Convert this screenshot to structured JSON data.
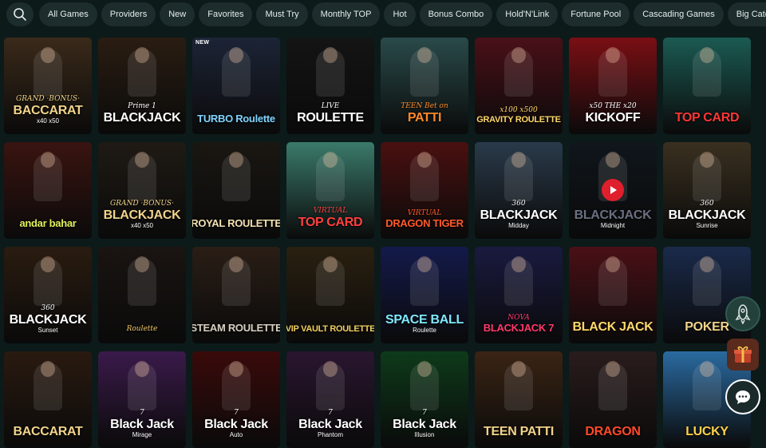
{
  "topbar": {
    "search_icon": "search-icon",
    "categories": [
      "All Games",
      "Providers",
      "New",
      "Favorites",
      "Must Try",
      "Monthly TOP",
      "Hot",
      "Bonus Combo",
      "Hold'N'Link",
      "Fortune Pool",
      "Cascading Games",
      "Big Catch"
    ]
  },
  "games": [
    {
      "sub": "GRAND ·BONUS·",
      "main": "BACCARAT",
      "tag": "x40  x50",
      "bg": "#3a2a1a",
      "accent": "#f2d48a"
    },
    {
      "sub": "Prime 1",
      "main": "BLACKJACK",
      "tag": "",
      "bg": "#2a1d12",
      "accent": "#ffffff"
    },
    {
      "new": "NEW",
      "sub": "",
      "main": "TURBO Roulette",
      "tag": "",
      "bg": "#1c2436",
      "accent": "#7fd4ff"
    },
    {
      "sub": "LIVE",
      "main": "ROULETTE",
      "tag": "",
      "bg": "#141414",
      "accent": "#ffffff"
    },
    {
      "sub": "TEEN Bet on",
      "main": "PATTI",
      "tag": "",
      "bg": "#2a4a4a",
      "accent": "#ff8a2a"
    },
    {
      "sub": "x100  x500",
      "main": "GRAVITY ROULETTE",
      "tag": "",
      "bg": "#4a1018",
      "accent": "#ffd76a"
    },
    {
      "sub": "x50 THE x20",
      "main": "KICKOFF",
      "tag": "",
      "bg": "#7a0f14",
      "accent": "#ffffff"
    },
    {
      "sub": "",
      "main": "TOP CARD",
      "tag": "",
      "bg": "#1b5a52",
      "accent": "#ff3636"
    },
    {
      "sub": "",
      "main": "andar bahar",
      "tag": "",
      "bg": "#3a1410",
      "accent": "#e0f05a"
    },
    {
      "sub": "GRAND ·BONUS·",
      "main": "BLACKJACK",
      "tag": "x40  x50",
      "bg": "#1f1a14",
      "accent": "#f2d48a"
    },
    {
      "sub": "",
      "main": "ROYAL ROULETTE",
      "tag": "",
      "bg": "#1a1712",
      "accent": "#f4e2b0"
    },
    {
      "sub": "VIRTUAL",
      "main": "TOP CARD",
      "tag": "",
      "bg": "#3a7a6a",
      "accent": "#ff4040"
    },
    {
      "sub": "VIRTUAL",
      "main": "DRAGON TIGER",
      "tag": "",
      "bg": "#4a1010",
      "accent": "#ff5a2a"
    },
    {
      "sub": "360",
      "main": "BLACKJACK",
      "tag": "Midday",
      "bg": "#2a3a4a",
      "accent": "#ffffff"
    },
    {
      "sub": "",
      "main": "BLACKJACK",
      "tag": "Midnight",
      "bg": "#10161c",
      "accent": "#6a7080"
    },
    {
      "sub": "360",
      "main": "BLACKJACK",
      "tag": "Sunrise",
      "bg": "#3a3020",
      "accent": "#ffffff"
    },
    {
      "sub": "360",
      "main": "BLACKJACK",
      "tag": "Sunset",
      "bg": "#2a1c10",
      "accent": "#ffffff"
    },
    {
      "sub": "Roulette",
      "main": "",
      "tag": "",
      "bg": "#1a1412",
      "accent": "#f2c86a"
    },
    {
      "sub": "",
      "main": "STEAM ROULETTE",
      "tag": "",
      "bg": "#2a1e16",
      "accent": "#d8d0c0"
    },
    {
      "sub": "",
      "main": "VIP VAULT ROULETTE",
      "tag": "",
      "bg": "#2a2010",
      "accent": "#f2d060"
    },
    {
      "sub": "",
      "main": "SPACE BALL",
      "tag": "Roulette",
      "bg": "#141a4a",
      "accent": "#7fe8ff"
    },
    {
      "sub": "NOVA",
      "main": "BLACKJACK 7",
      "tag": "",
      "bg": "#1a1a40",
      "accent": "#ff3a6a"
    },
    {
      "sub": "",
      "main": "BLACK JACK",
      "tag": "",
      "bg": "#4a1016",
      "accent": "#ffd86a"
    },
    {
      "sub": "",
      "main": "POKER",
      "tag": "",
      "bg": "#1a2a4a",
      "accent": "#f2d48a"
    },
    {
      "sub": "",
      "main": "BACCARAT",
      "tag": "",
      "bg": "#2a1a10",
      "accent": "#f2d48a"
    },
    {
      "sub": "7",
      "main": "Black Jack",
      "tag": "Mirage",
      "bg": "#3a1a4a",
      "accent": "#ffffff"
    },
    {
      "sub": "7",
      "main": "Black Jack",
      "tag": "Auto",
      "bg": "#3a0a0a",
      "accent": "#ffffff"
    },
    {
      "sub": "7",
      "main": "Black Jack",
      "tag": "Phantom",
      "bg": "#2a1630",
      "accent": "#ffffff"
    },
    {
      "sub": "7",
      "main": "Black Jack",
      "tag": "Illusion",
      "bg": "#0e3a1a",
      "accent": "#ffffff"
    },
    {
      "sub": "",
      "main": "TEEN PATTI",
      "tag": "",
      "bg": "#3a2414",
      "accent": "#f2d48a"
    },
    {
      "sub": "",
      "main": "DRAGON",
      "tag": "",
      "bg": "#2a1c1c",
      "accent": "#ff4a2a"
    },
    {
      "sub": "",
      "main": "LUCKY",
      "tag": "",
      "bg": "#2a6aa0",
      "accent": "#ffd24a"
    }
  ],
  "floating": {
    "rocket_icon": "rocket-icon",
    "gift_icon": "gift-icon",
    "chat_icon": "chat-icon"
  },
  "colors": {
    "background": "#0c1a1a",
    "chip_bg": "#1d2d2d",
    "play_red": "#e01f2d"
  }
}
